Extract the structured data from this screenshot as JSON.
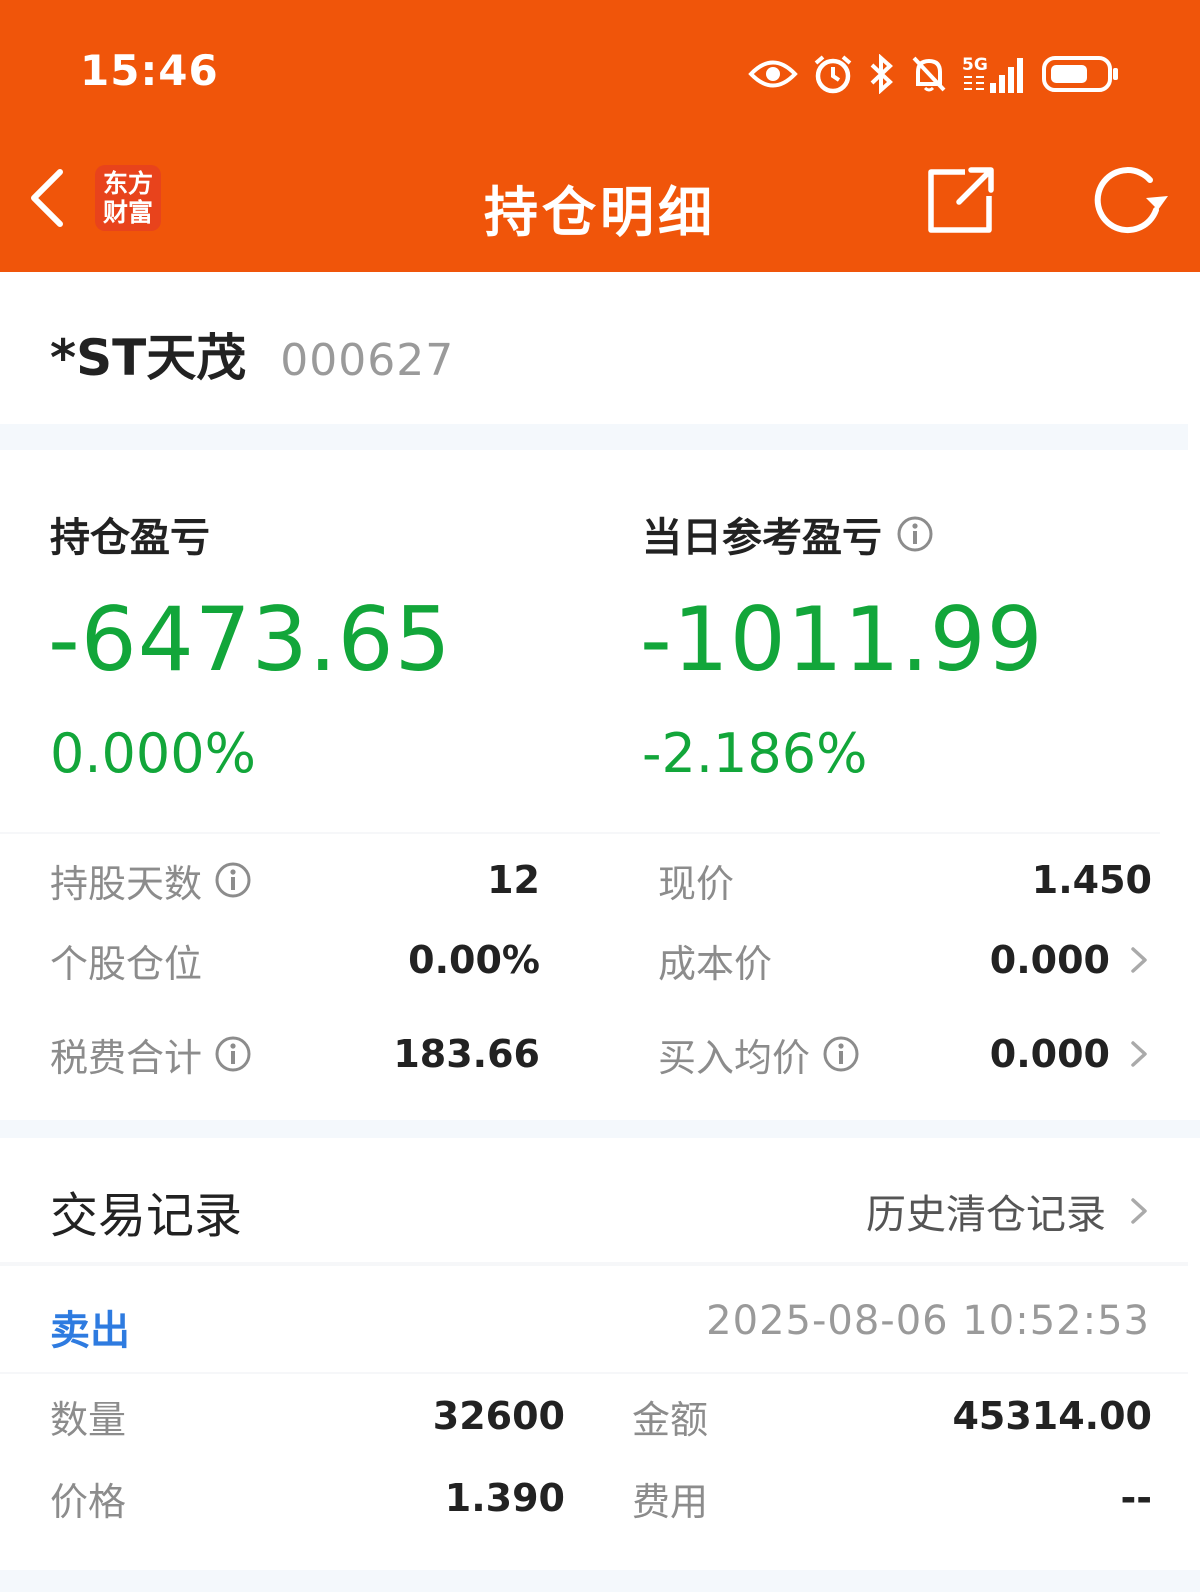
{
  "status": {
    "time": "15:46",
    "network": "5G"
  },
  "nav": {
    "title": "持仓明细",
    "logo_line1": "东方",
    "logo_line2": "财富"
  },
  "stock": {
    "name": "*ST天茂",
    "code": "000627"
  },
  "pl": {
    "position_label": "持仓盈亏",
    "position_value": "-6473.65",
    "position_pct": "0.000%",
    "daily_label": "当日参考盈亏",
    "daily_value": "-1011.99",
    "daily_pct": "-2.186%"
  },
  "details": {
    "hold_days_label": "持股天数",
    "hold_days": "12",
    "position_ratio_label": "个股仓位",
    "position_ratio": "0.00%",
    "tax_fee_label": "税费合计",
    "tax_fee": "183.66",
    "current_price_label": "现价",
    "current_price": "1.450",
    "cost_price_label": "成本价",
    "cost_price": "0.000",
    "avg_buy_label": "买入均价",
    "avg_buy": "0.000"
  },
  "trades": {
    "title": "交易记录",
    "history_link": "历史清仓记录",
    "records": [
      {
        "type": "卖出",
        "time": "2025-08-06 10:52:53",
        "qty_label": "数量",
        "qty": "32600",
        "amount_label": "金额",
        "amount": "45314.00",
        "price_label": "价格",
        "price": "1.390",
        "fee_label": "费用",
        "fee": "--"
      }
    ]
  },
  "colors": {
    "header": "#f0550a",
    "loss": "#12a63a",
    "sell": "#2e7be0"
  }
}
